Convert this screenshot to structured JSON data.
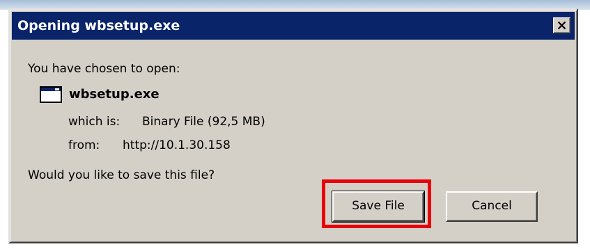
{
  "dialog": {
    "title": "Opening wbsetup.exe",
    "close_icon": "close-icon",
    "intro": "You have chosen to open:",
    "file": {
      "icon": "application-window-icon",
      "name": "wbsetup.exe",
      "type_label": "which is:",
      "type_value": "Binary File (92,5 MB)",
      "from_label": "from:",
      "from_value": "http://10.1.30.158"
    },
    "question": "Would you like to save this file?",
    "buttons": {
      "save": "Save File",
      "cancel": "Cancel"
    },
    "highlight_color": "#e8000b",
    "titlebar_color": "#0a246a"
  }
}
